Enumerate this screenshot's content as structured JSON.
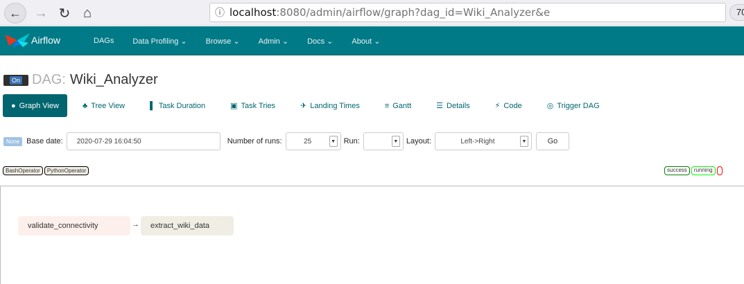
{
  "browser": {
    "url_info_icon": "info-icon",
    "url_host": "localhost",
    "url_rest": ":8080/admin/airflow/graph?dag_id=Wiki_Analyzer&e",
    "zoom": "70"
  },
  "navbar": {
    "brand": "Airflow",
    "items": [
      "DAGs",
      "Data Profiling ⌄",
      "Browse ⌄",
      "Admin ⌄",
      "Docs ⌄",
      "About ⌄"
    ]
  },
  "dag": {
    "toggle_label": "On",
    "label": "DAG:",
    "name": "Wiki_Analyzer"
  },
  "tabs": [
    {
      "label": "Graph View",
      "icon": "●"
    },
    {
      "label": "Tree View",
      "icon": "♣"
    },
    {
      "label": "Task Duration",
      "icon": "▌"
    },
    {
      "label": "Task Tries",
      "icon": "▣"
    },
    {
      "label": "Landing Times",
      "icon": "✈"
    },
    {
      "label": "Gantt",
      "icon": "≡"
    },
    {
      "label": "Details",
      "icon": "☰"
    },
    {
      "label": "Code",
      "icon": "⚡"
    },
    {
      "label": "Trigger DAG",
      "icon": "◎"
    }
  ],
  "controls": {
    "none_badge": "None",
    "base_date_label": "Base date:",
    "base_date_value": "2020-07-29 16:04:50",
    "num_runs_label": "Number of runs:",
    "num_runs_value": "25",
    "run_label": "Run:",
    "run_value": "",
    "layout_label": "Layout:",
    "layout_value": "Left->Right",
    "go_label": "Go"
  },
  "operators": [
    "BashOperator",
    "PythonOperator"
  ],
  "states": [
    {
      "label": "success",
      "color": "#008000"
    },
    {
      "label": "running",
      "color": "#00ff00"
    },
    {
      "label": "",
      "color": "#ff0000"
    }
  ],
  "graph": {
    "nodes": [
      "validate_connectivity",
      "extract_wiki_data"
    ],
    "edge": "→"
  }
}
